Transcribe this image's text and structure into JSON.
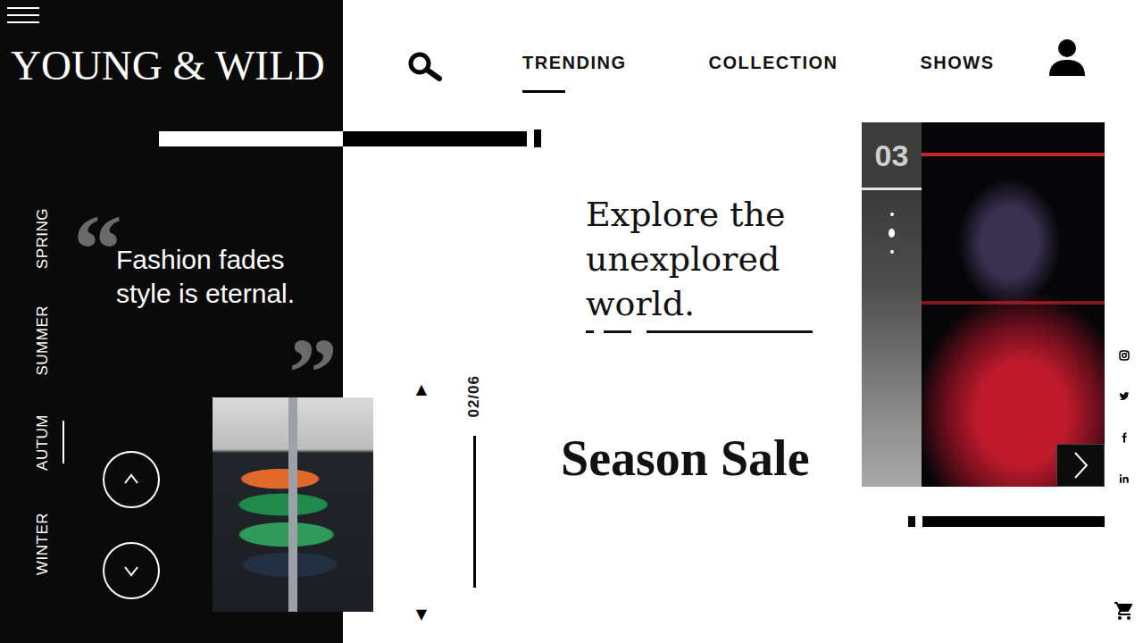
{
  "brand": "YOUNG & WILD",
  "nav": [
    {
      "label": "TRENDING",
      "selected": true
    },
    {
      "label": "COLLECTION",
      "selected": false
    },
    {
      "label": "SHOWS",
      "selected": false
    }
  ],
  "seasons": [
    {
      "label": "SPRING",
      "selected": false
    },
    {
      "label": "SUMMER",
      "selected": false
    },
    {
      "label": "AUTUM",
      "selected": true
    },
    {
      "label": "WINTER",
      "selected": false
    }
  ],
  "quote": {
    "open": "“",
    "lines": [
      "Fashion fades",
      "style is eternal."
    ],
    "close": "”"
  },
  "slider": {
    "up": "▲",
    "counter": "02/06",
    "down": "▼"
  },
  "hero": {
    "headline": [
      "Explore the",
      "unexplored",
      "world."
    ],
    "sale": "Season Sale"
  },
  "feature": {
    "index": "03",
    "dots": [
      {
        "selected": false
      },
      {
        "selected": true
      },
      {
        "selected": false
      }
    ]
  }
}
